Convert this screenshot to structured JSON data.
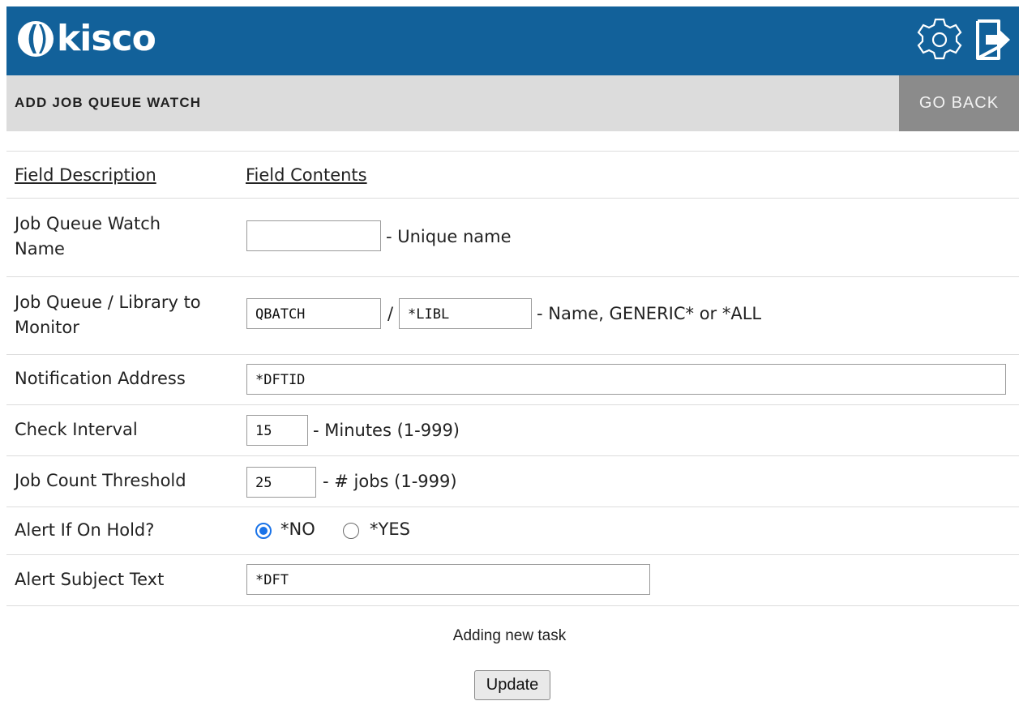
{
  "header": {
    "logo_text": "kisco"
  },
  "title_bar": {
    "title": "ADD JOB QUEUE WATCH",
    "go_back": "GO BACK"
  },
  "table_headers": {
    "description": "Field Description",
    "contents": "Field Contents"
  },
  "fields": {
    "watch_name": {
      "label_line1": "Job Queue Watch",
      "label_line2": "Name",
      "value": "",
      "hint": "- Unique name"
    },
    "job_queue": {
      "label_line1": "Job Queue / Library to",
      "label_line2": "Monitor",
      "queue_value": "QBATCH",
      "separator": "/",
      "library_value": "*LIBL",
      "hint": "- Name, GENERIC* or *ALL"
    },
    "notification": {
      "label": "Notification Address",
      "value": "*DFTID"
    },
    "interval": {
      "label": "Check Interval",
      "value": "15",
      "hint": "- Minutes (1-999)"
    },
    "threshold": {
      "label": "Job Count Threshold",
      "value": "25",
      "hint": "- # jobs (1-999)"
    },
    "hold": {
      "label": "Alert If On Hold?",
      "option_no": "*NO",
      "option_yes": "*YES",
      "selected": "*NO"
    },
    "subject": {
      "label": "Alert Subject Text",
      "value": "*DFT"
    }
  },
  "status_text": "Adding new task",
  "update_label": "Update",
  "colors": {
    "header_bg": "#12619a",
    "title_bar_bg": "#dcdcdc",
    "go_back_bg": "#8b8b8b",
    "radio_accent": "#1a73e8"
  }
}
